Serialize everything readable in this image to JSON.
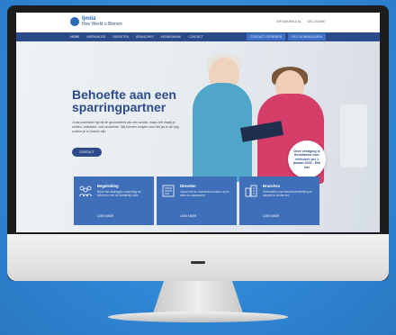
{
  "site": {
    "logo_line1": "Ijmila",
    "logo_line2": "Hoe Werkt u Binnen",
    "toplinks": [
      "INFO@IJMILA.NL",
      "020-1234567"
    ]
  },
  "nav": {
    "items": [
      "HOME",
      "WERKWIJZE",
      "DIENSTEN",
      "BRANCHES",
      "KENNISBANK",
      "CONTACT"
    ],
    "buttons": [
      "CONTACT OPNEMEN",
      "FILE DOWNLOADEN"
    ]
  },
  "hero": {
    "headline_line1": "Behoefte aan een",
    "headline_line2": "sparringpartner",
    "intro": "Jouw potentieel ligt bij de gezondheid van een sector, maar zelf maak je zelden, ontwikkel, ook zeurkeren. Wij kunnen zorgen voor het pa in de nog ouders je zo lossen zijn.",
    "contact_button": "CONTACT",
    "badge": "Deze vestiging is thuishaven voor verhuizen per 1 januari 2026 - Klik hier"
  },
  "cards": [
    {
      "title": "Begeleiding",
      "text": "Bij de het aanleggen onderslag en beleid en met de bedrijfslijn zien.",
      "link": "LEES MEER",
      "icon": "people-icon"
    },
    {
      "title": "Diensten",
      "text": "Jouwe het de onderbouw maken op en actie tot aanpassen.",
      "link": "LEES MEER",
      "icon": "document-icon"
    },
    {
      "title": "Branches",
      "text": "Onderdelen van brancheversterking en aanpak te vinden tot.",
      "link": "LEES MEER",
      "icon": "building-icon"
    }
  ]
}
